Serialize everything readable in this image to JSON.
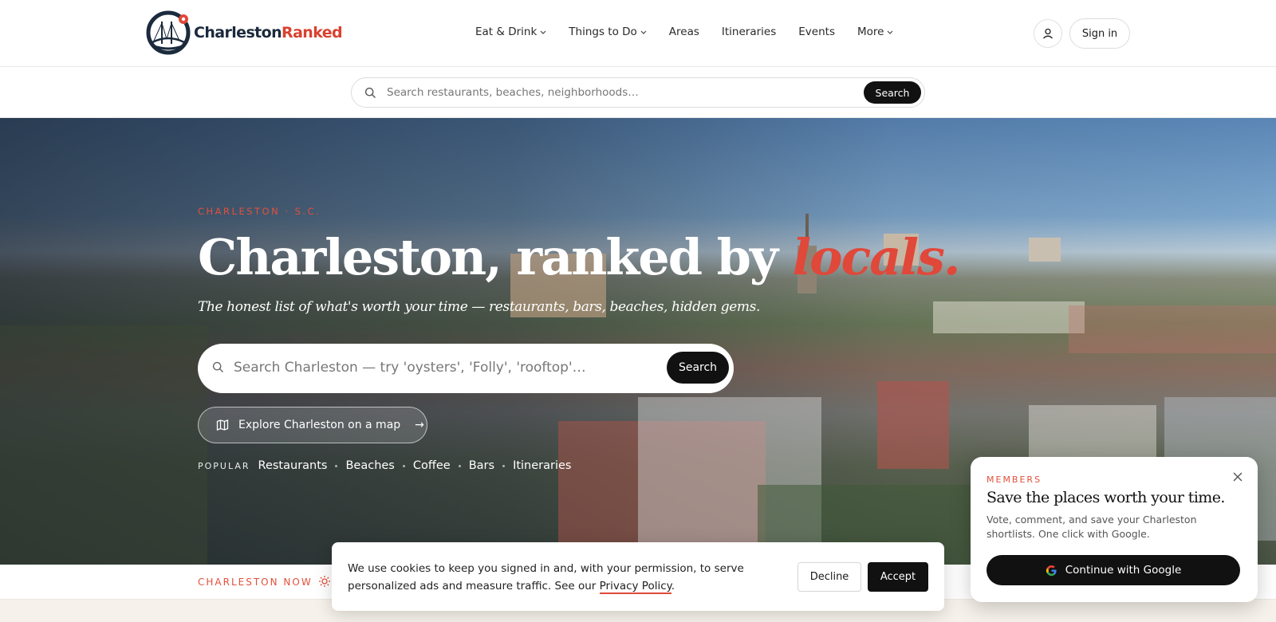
{
  "header": {
    "logo": {
      "part1": "Charleston",
      "part2": "Ranked"
    },
    "nav": [
      {
        "label": "Eat & Drink",
        "has_dropdown": true
      },
      {
        "label": "Things to Do",
        "has_dropdown": true
      },
      {
        "label": "Areas",
        "has_dropdown": false
      },
      {
        "label": "Itineraries",
        "has_dropdown": false
      },
      {
        "label": "Events",
        "has_dropdown": false
      },
      {
        "label": "More",
        "has_dropdown": true
      }
    ],
    "user_icon": "user-icon",
    "signin_label": "Sign in"
  },
  "subsearch": {
    "placeholder": "Search restaurants, beaches, neighborhoods…",
    "button_label": "Search",
    "icon": "search-icon"
  },
  "hero": {
    "eyebrow": "CHARLESTON · S.C.",
    "title_main": "Charleston, ranked by ",
    "title_accent": "locals.",
    "subtitle": "The honest list of what's worth your time — restaurants, bars, beaches, hidden gems.",
    "search_placeholder": "Search Charleston — try 'oysters', 'Folly', 'rooftop'…",
    "search_button": "Search",
    "map_button": "Explore Charleston on a map",
    "map_arrow": "→",
    "popular_label": "POPULAR",
    "popular": [
      "Restaurants",
      "Beaches",
      "Coffee",
      "Bars",
      "Itineraries"
    ]
  },
  "ticker": {
    "label": "CHARLESTON NOW",
    "icon": "sun-icon"
  },
  "cookie": {
    "text_before": "We use cookies to keep you signed in and, with your permission, to serve personalized ads and measure traffic. See our ",
    "link": "Privacy Policy",
    "text_after": ".",
    "decline": "Decline",
    "accept": "Accept"
  },
  "members": {
    "eyebrow": "MEMBERS",
    "title": "Save the places worth your time.",
    "description": "Vote, comment, and save your Charleston shortlists. One click with Google.",
    "google_button": "Continue with Google"
  },
  "colors": {
    "accent": "#e0483a",
    "dark": "#111111",
    "navy": "#1b2a3c"
  }
}
